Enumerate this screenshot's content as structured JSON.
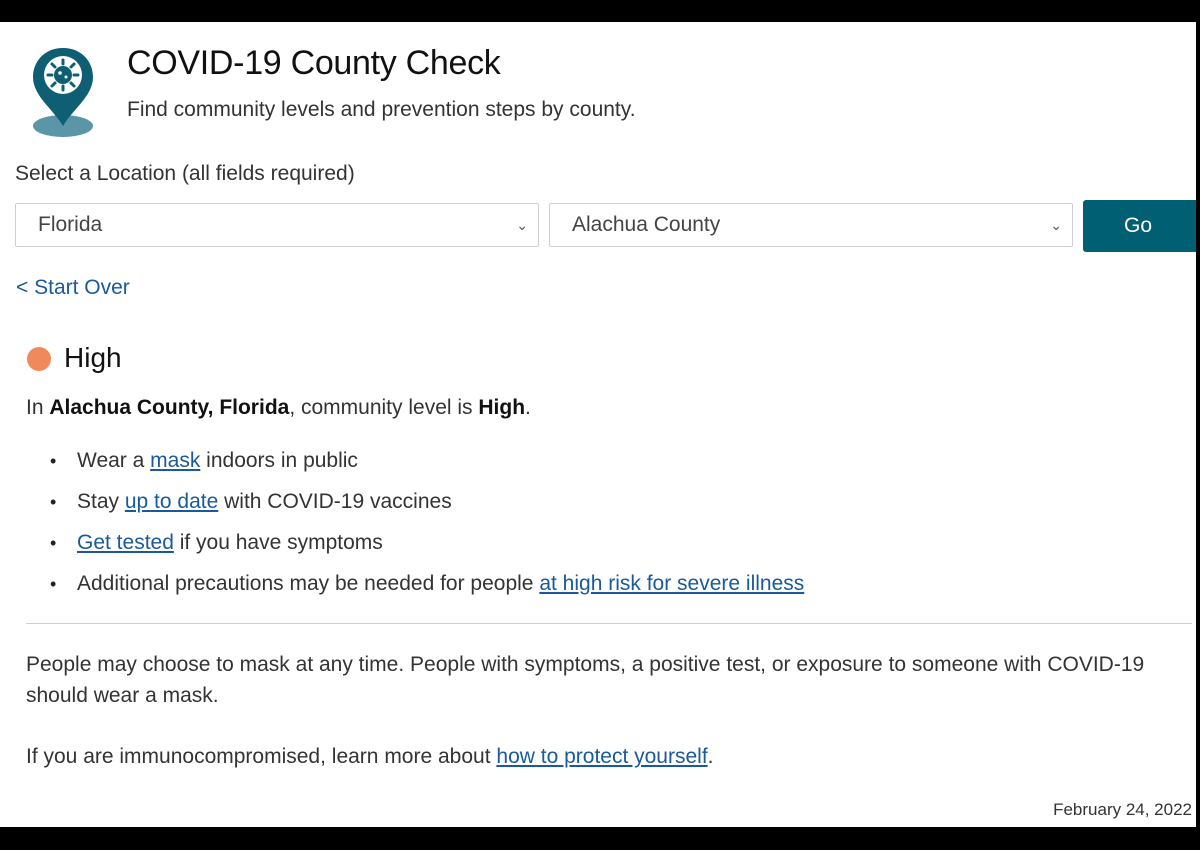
{
  "header": {
    "logo_icon": "location-pin-virus-icon",
    "title": "COVID-19 County Check",
    "subtitle": "Find community levels and prevention steps by county."
  },
  "location": {
    "label": "Select a Location (all fields required)",
    "state_selected": "Florida",
    "county_selected": "Alachua County",
    "go_label": "Go"
  },
  "start_over_label": "< Start Over",
  "result": {
    "level": "High",
    "level_color": "#f08a5d",
    "summary_prefix": "In ",
    "summary_place": "Alachua County, Florida",
    "summary_mid": ", community level is ",
    "summary_level": "High",
    "summary_end": "."
  },
  "prevention": [
    {
      "before": "Wear a ",
      "link": "mask",
      "after": " indoors in public"
    },
    {
      "before": "Stay ",
      "link": "up to date",
      "after": " with COVID-19 vaccines"
    },
    {
      "before": "",
      "link": "Get tested",
      "after": " if you have symptoms"
    },
    {
      "before": "Additional precautions may be needed for people ",
      "link": "at high risk for severe illness",
      "after": ""
    }
  ],
  "note": "People may choose to mask at any time. People with symptoms, a positive test, or exposure to someone with COVID-19 should wear a mask.",
  "immuno": {
    "before": "If you are immunocompromised, learn more about ",
    "link": "how to protect yourself",
    "after": "."
  },
  "date": "February 24, 2022",
  "colors": {
    "accent": "#005f73",
    "link": "#1a5a9c"
  }
}
